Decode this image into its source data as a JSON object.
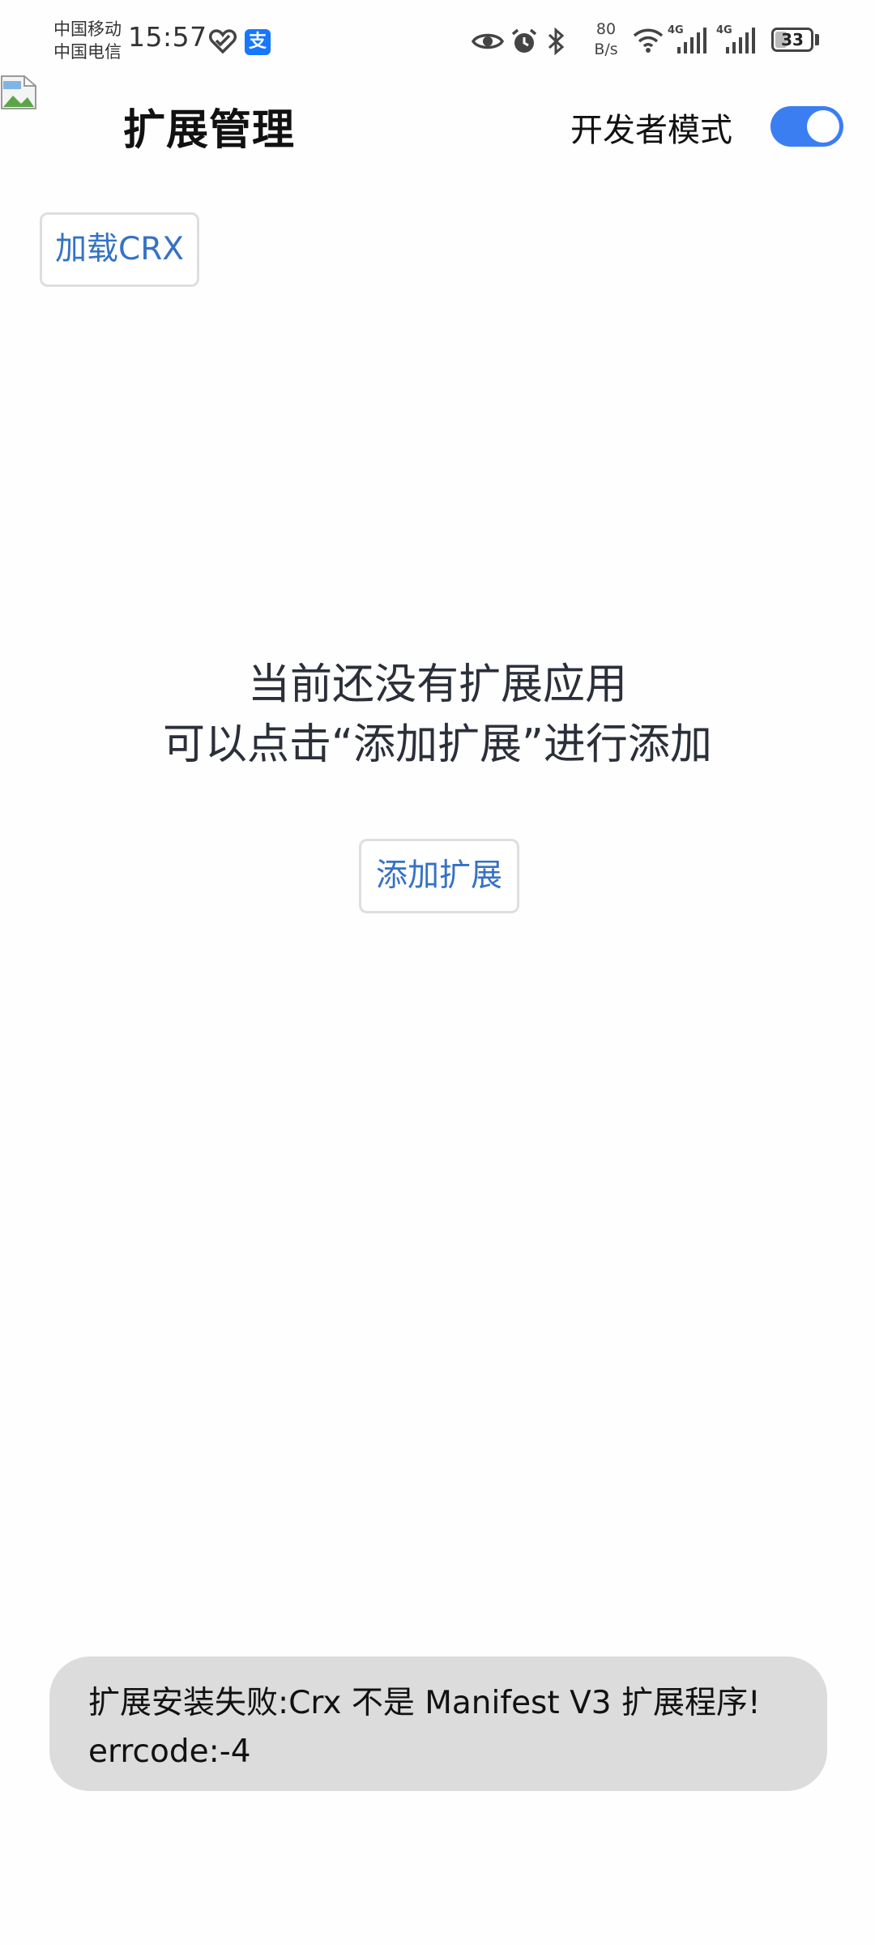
{
  "status_bar": {
    "carrier_1": "中国移动",
    "carrier_2": "中国电信",
    "time": "15:57",
    "alipay_glyph": "支",
    "net_speed_value": "80",
    "net_speed_unit": "B/s",
    "signal_1_label": "4G",
    "signal_2_label": "4G",
    "battery_level": "33",
    "battery_fraction": 0.33,
    "icons": [
      "heart-health-icon",
      "alipay-icon",
      "eye-icon",
      "alarm-icon",
      "bluetooth-icon",
      "wifi-icon",
      "signal-icon",
      "signal-icon",
      "battery-icon"
    ]
  },
  "header": {
    "title": "扩展管理",
    "dev_mode_label": "开发者模式",
    "dev_mode_enabled": true,
    "accent_color": "#3b7ef2"
  },
  "actions": {
    "load_crx_label": "加载CRX",
    "add_extension_label": "添加扩展"
  },
  "empty_state": {
    "line_1": "当前还没有扩展应用",
    "line_2": "可以点击“添加扩展”进行添加"
  },
  "toast": {
    "line_1": "扩展安装失败:Crx 不是 Manifest V3 扩展程序!",
    "line_2": "errcode:-4"
  }
}
